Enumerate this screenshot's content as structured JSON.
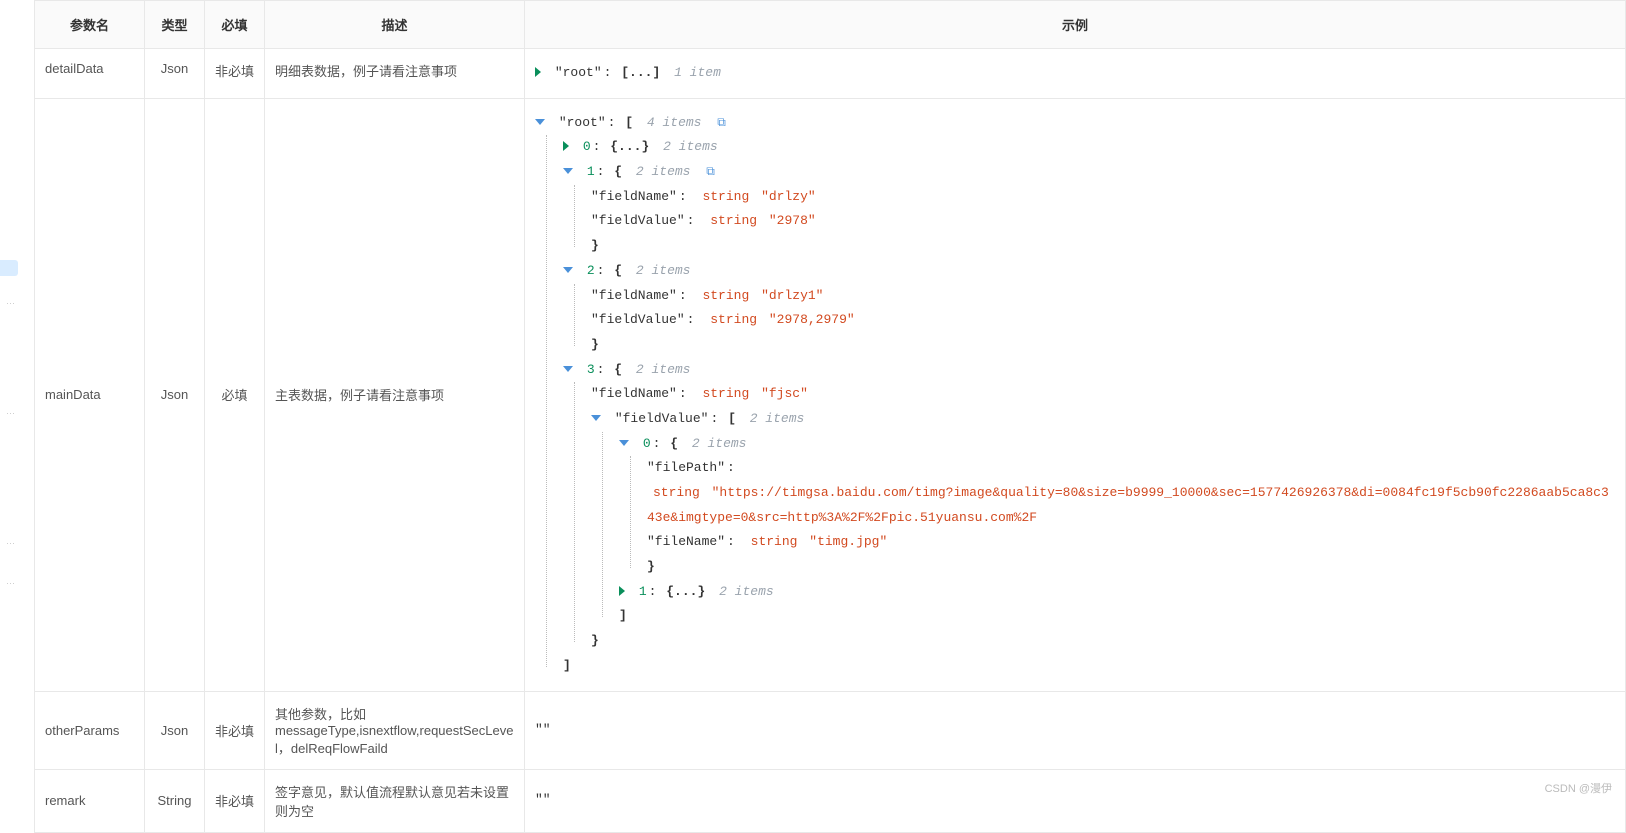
{
  "table": {
    "headers": {
      "name": "参数名",
      "type": "类型",
      "required": "必填",
      "desc": "描述",
      "example": "示例"
    },
    "rows": [
      {
        "name": "detailData",
        "type": "Json",
        "required": "非必填",
        "desc": "明细表数据，例子请看注意事项"
      },
      {
        "name": "mainData",
        "type": "Json",
        "required": "必填",
        "desc": "主表数据，例子请看注意事项"
      },
      {
        "name": "otherParams",
        "type": "Json",
        "required": "非必填",
        "desc": "其他参数，比如messageType,isnextflow,requestSecLevel，delReqFlowFaild"
      },
      {
        "name": "remark",
        "type": "String",
        "required": "非必填",
        "desc": "签字意见，默认值流程默认意见若未设置则为空"
      }
    ]
  },
  "json_labels": {
    "root": "\"root\"",
    "item1": "1 item",
    "items2": "2 items",
    "items4": "4 items",
    "string_type": "string",
    "fieldName": "\"fieldName\"",
    "fieldValue": "\"fieldValue\"",
    "filePath": "\"filePath\"",
    "fileName": "\"fileName\"",
    "collapsed_arr": "[...]",
    "collapsed_obj": "{...}"
  },
  "json_values": {
    "r0_row1_fieldName": "\"drlzy\"",
    "r0_row1_fieldValue": "\"2978\"",
    "r0_row2_fieldName": "\"drlzy1\"",
    "r0_row2_fieldValue": "\"2978,2979\"",
    "r0_row3_fieldName": "\"fjsc\"",
    "filePath_url": "\"https://timgsa.baidu.com/timg?image&quality=80&size=b9999_10000&sec=1577426926378&di=0084fc19f5cb90fc2286aab5ca8c343e&imgtype=0&src=http%3A%2F%2Fpic.51yuansu.com%2F",
    "fileName_val": "\"timg.jpg\""
  },
  "misc": {
    "empty_quotes": "\"\"",
    "watermark": "CSDN @漫伊"
  }
}
